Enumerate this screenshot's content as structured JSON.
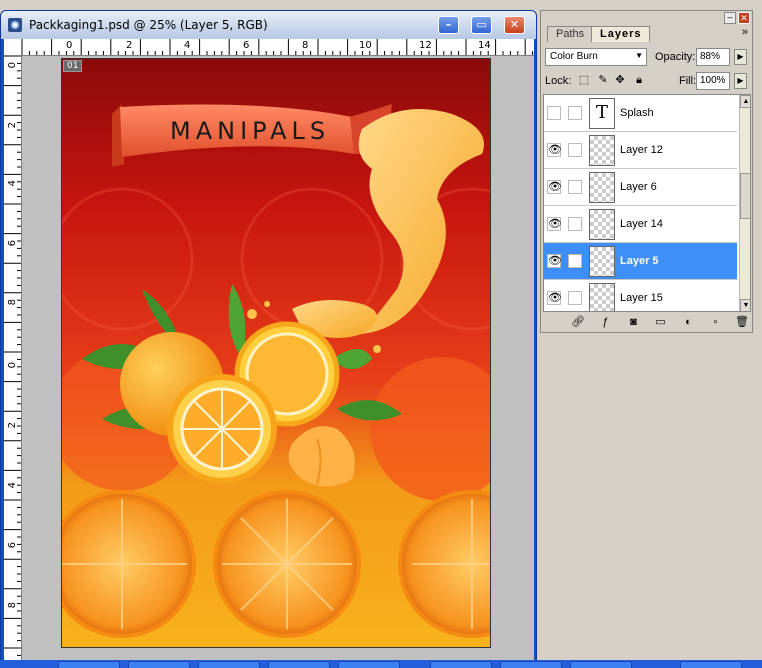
{
  "window": {
    "title": "Packkaging1.psd @ 25% (Layer 5, RGB)",
    "minimize_glyph": "–",
    "maximize_glyph": "▭",
    "close_glyph": "✕"
  },
  "ruler": {
    "top_labels": [
      "0",
      "2",
      "4",
      "6",
      "8",
      "10",
      "12",
      "14"
    ],
    "left_labels": [
      "0",
      "2",
      "4",
      "6",
      "8",
      "0",
      "2",
      "4",
      "6",
      "8"
    ]
  },
  "canvas": {
    "slice_badge": "01",
    "brand_text": "MANIPALS"
  },
  "panel": {
    "tabs": [
      "Paths",
      "Layers"
    ],
    "menu_glyph": "»",
    "blend_mode": "Color Burn",
    "opacity_label": "Opacity:",
    "opacity_value": "88%",
    "lock_label": "Lock:",
    "fill_label": "Fill:",
    "fill_value": "100%",
    "layers": [
      {
        "name": "Splash",
        "type": "text",
        "visible": false,
        "thumb_glyph": "T"
      },
      {
        "name": "Layer 12",
        "type": "image",
        "visible": true
      },
      {
        "name": "Layer 6",
        "type": "image",
        "visible": true
      },
      {
        "name": "Layer 14",
        "type": "image",
        "visible": true
      },
      {
        "name": "Layer 5",
        "type": "image",
        "visible": true,
        "selected": true
      },
      {
        "name": "Layer 15",
        "type": "image",
        "visible": true
      }
    ]
  },
  "colors": {
    "selection": "#3d8ef7",
    "bg_red": "#c21a14",
    "bg_orange": "#f7a314"
  }
}
